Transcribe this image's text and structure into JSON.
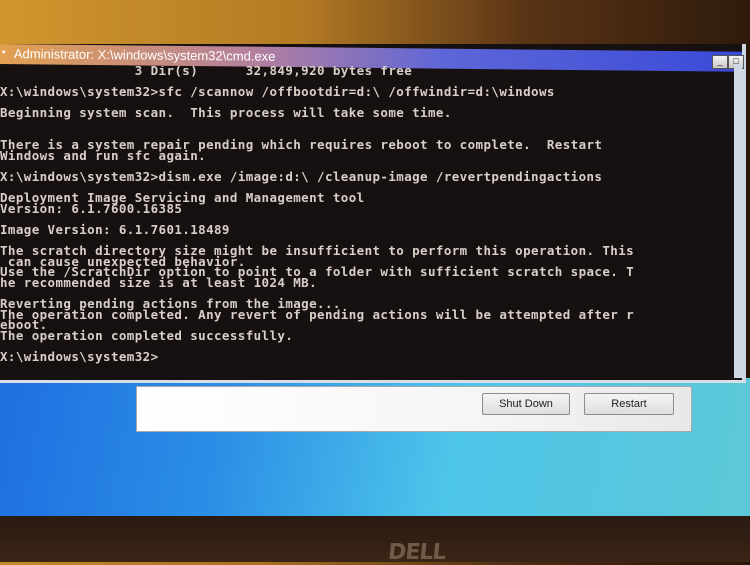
{
  "window": {
    "title": "Administrator: X:\\windows\\system32\\cmd.exe",
    "icon": "cmd-icon",
    "controls": {
      "minimize": "_",
      "maximize": "□"
    }
  },
  "console": {
    "lines": [
      "                 3 Dir(s)      32,849,920 bytes free",
      "",
      "X:\\windows\\system32>sfc /scannow /offbootdir=d:\\ /offwindir=d:\\windows",
      "",
      "Beginning system scan.  This process will take some time.",
      "",
      "",
      "There is a system repair pending which requires reboot to complete.  Restart",
      "Windows and run sfc again.",
      "",
      "X:\\windows\\system32>dism.exe /image:d:\\ /cleanup-image /revertpendingactions",
      "",
      "Deployment Image Servicing and Management tool",
      "Version: 6.1.7600.16385",
      "",
      "Image Version: 6.1.7601.18489",
      "",
      "The scratch directory size might be insufficient to perform this operation. This",
      " can cause unexpected behavior.",
      "Use the /ScratchDir option to point to a folder with sufficient scratch space. T",
      "he recommended size is at least 1024 MB.",
      "",
      "Reverting pending actions from the image...",
      "The operation completed. Any revert of pending actions will be attempted after r",
      "eboot.",
      "The operation completed successfully.",
      "",
      "X:\\windows\\system32>"
    ]
  },
  "dialog": {
    "shutdown_label": "Shut Down",
    "restart_label": "Restart"
  },
  "bezel": {
    "brand": "DELL"
  }
}
